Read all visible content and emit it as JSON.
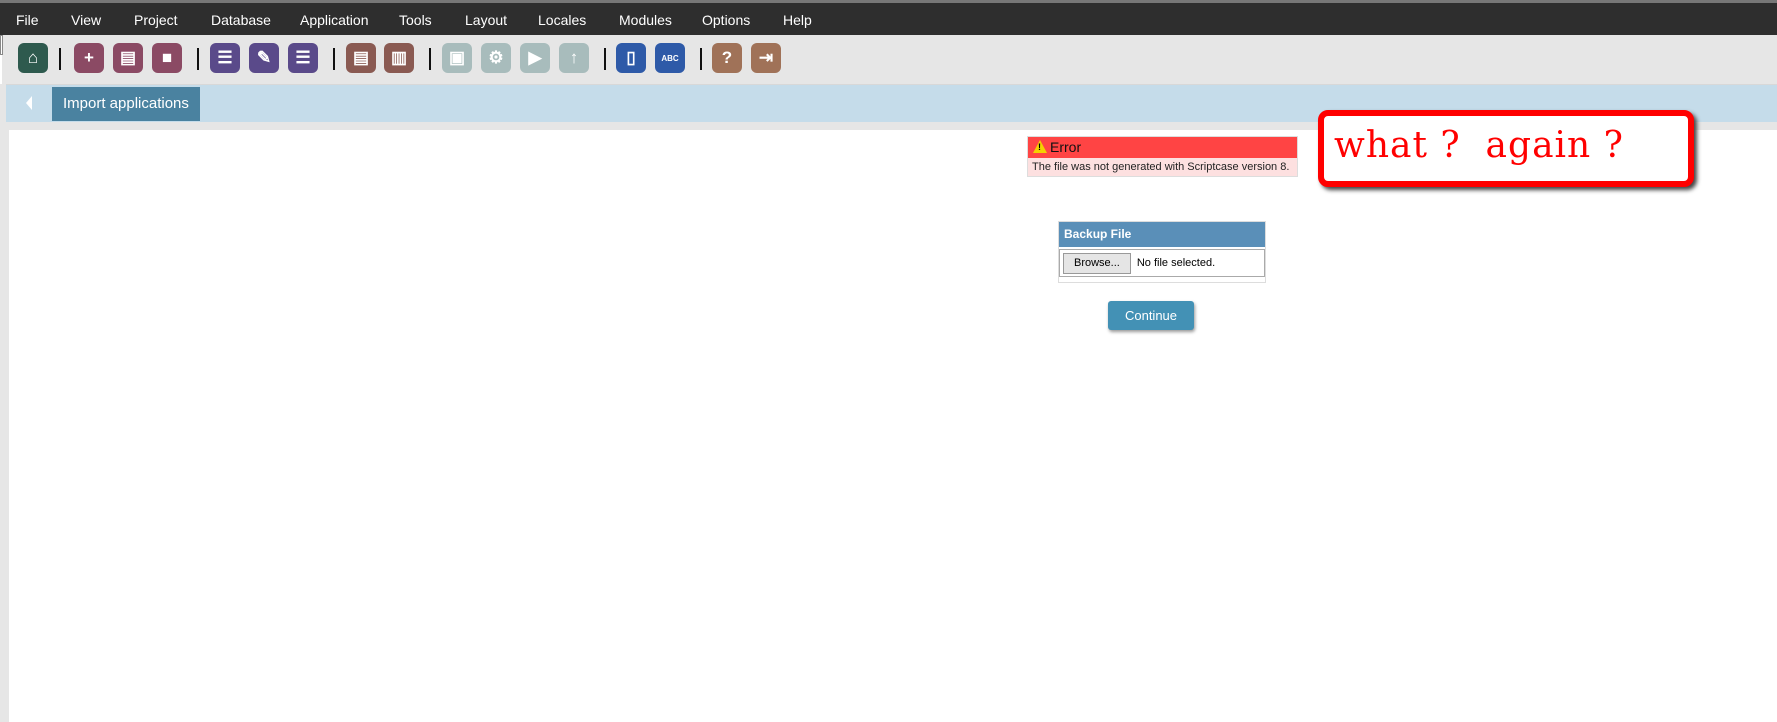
{
  "menu": [
    "File",
    "View",
    "Project",
    "Database",
    "Application",
    "Tools",
    "Layout",
    "Locales",
    "Modules",
    "Options",
    "Help"
  ],
  "toolbar": [
    {
      "name": "home-icon",
      "color": "#2e5a4e",
      "glyph": "⌂"
    },
    {
      "name": "new-project-icon",
      "color": "#8b4a64",
      "glyph": "+"
    },
    {
      "name": "open-project-icon",
      "color": "#8b4a64",
      "glyph": "▤"
    },
    {
      "name": "project-box-icon",
      "color": "#8b4a64",
      "glyph": "■"
    },
    {
      "name": "new-application-icon",
      "color": "#5a4a8a",
      "glyph": "☰"
    },
    {
      "name": "edit-application-icon",
      "color": "#5a4a8a",
      "glyph": "✎"
    },
    {
      "name": "application-list-icon",
      "color": "#5a4a8a",
      "glyph": "☰"
    },
    {
      "name": "document-icon",
      "color": "#8a5a52",
      "glyph": "▤"
    },
    {
      "name": "documents-icon",
      "color": "#8a5a52",
      "glyph": "▥"
    },
    {
      "name": "save-icon",
      "color": "#a8bcbc",
      "glyph": "▣"
    },
    {
      "name": "generate-icon",
      "color": "#a8bcbc",
      "glyph": "⚙"
    },
    {
      "name": "run-icon",
      "color": "#a8bcbc",
      "glyph": "▶"
    },
    {
      "name": "deploy-icon",
      "color": "#a8bcbc",
      "glyph": "↑"
    },
    {
      "name": "book-icon",
      "color": "#2e5aa8",
      "glyph": "▯"
    },
    {
      "name": "spellcheck-icon",
      "color": "#2e5aa8",
      "glyph": "ABC"
    },
    {
      "name": "help-icon",
      "color": "#a07258",
      "glyph": "?"
    },
    {
      "name": "exit-icon",
      "color": "#a07258",
      "glyph": "⇥"
    }
  ],
  "tab": {
    "label": "Import applications"
  },
  "error": {
    "title": "Error",
    "message": "The file was not generated with Scriptcase version 8."
  },
  "callout": {
    "text": "what ?  again ?"
  },
  "backup": {
    "title": "Backup File",
    "browse": "Browse...",
    "status": "No file selected."
  },
  "continue_label": "Continue"
}
